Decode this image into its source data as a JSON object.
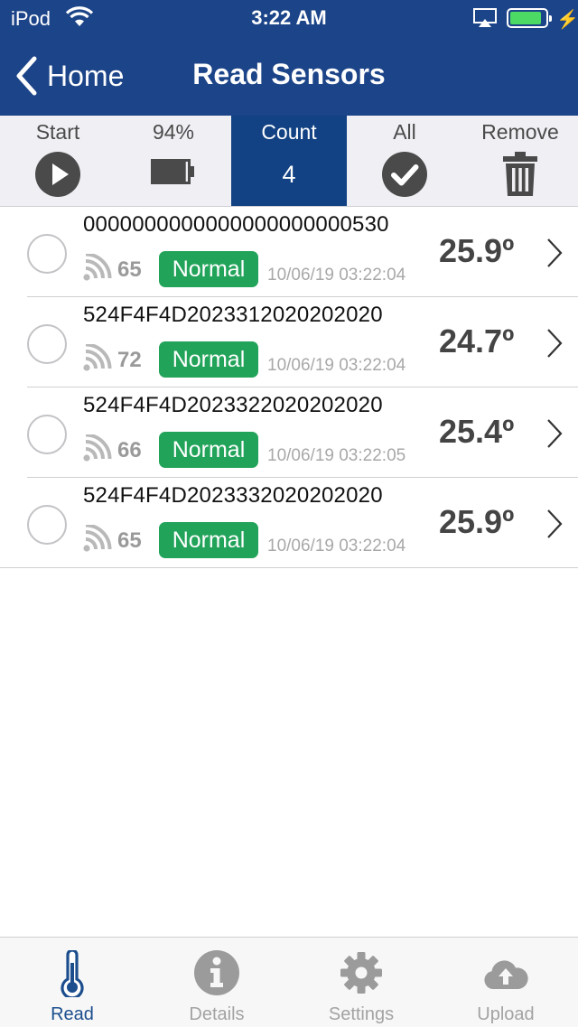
{
  "status_bar": {
    "carrier": "iPod",
    "time": "3:22 AM",
    "battery_level": 0.9,
    "icons": [
      "wifi-icon",
      "airplay-icon",
      "battery-icon",
      "charging-bolt-icon"
    ]
  },
  "nav": {
    "back_label": "Home",
    "title": "Read Sensors",
    "bar_color": "#1c4488"
  },
  "toolbar": {
    "start": {
      "label": "Start",
      "icon": "play-icon"
    },
    "battery": {
      "label": "94%",
      "icon": "battery-icon"
    },
    "count": {
      "label": "Count",
      "value": "4",
      "active_color": "#124283"
    },
    "all": {
      "label": "All",
      "icon": "checkmark-icon"
    },
    "remove": {
      "label": "Remove",
      "icon": "trash-icon"
    }
  },
  "sensors": [
    {
      "id": "0000000000000000000000530",
      "rssi": "65",
      "status": "Normal",
      "timestamp": "10/06/19 03:22:04",
      "temperature": "25.9º"
    },
    {
      "id": "524F4F4D2023312020202020",
      "rssi": "72",
      "status": "Normal",
      "timestamp": "10/06/19 03:22:04",
      "temperature": "24.7º"
    },
    {
      "id": "524F4F4D2023322020202020",
      "rssi": "66",
      "status": "Normal",
      "timestamp": "10/06/19 03:22:05",
      "temperature": "25.4º"
    },
    {
      "id": "524F4F4D2023332020202020",
      "rssi": "65",
      "status": "Normal",
      "timestamp": "10/06/19 03:22:04",
      "temperature": "25.9º"
    }
  ],
  "status_color": "#22a35a",
  "tabs": [
    {
      "label": "Read",
      "icon": "thermometer-icon",
      "active": true
    },
    {
      "label": "Details",
      "icon": "info-icon",
      "active": false
    },
    {
      "label": "Settings",
      "icon": "gear-icon",
      "active": false
    },
    {
      "label": "Upload",
      "icon": "cloud-upload-icon",
      "active": false
    }
  ]
}
